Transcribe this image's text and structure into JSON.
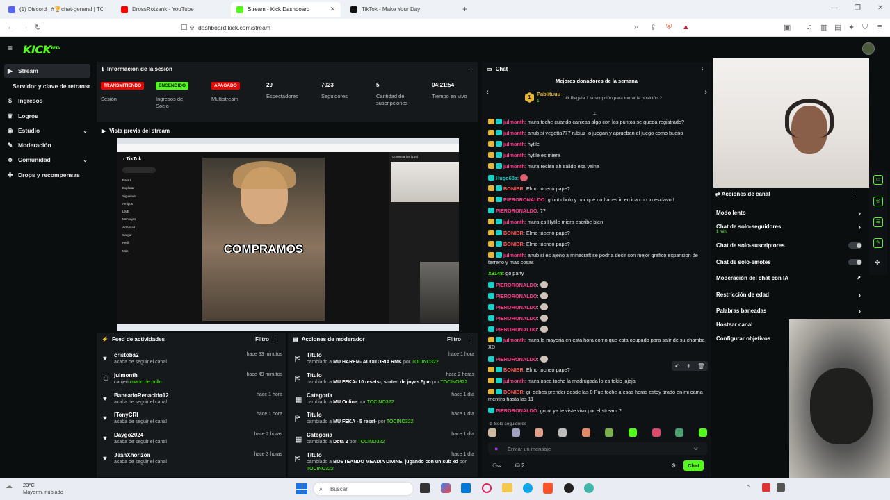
{
  "browser": {
    "tabs": [
      {
        "label": "(1) Discord | #🏆chat-general | TO",
        "color": "#5865f2"
      },
      {
        "label": "DrossRotzank - YouTube",
        "color": "#ff0000"
      },
      {
        "label": "Stream - Kick Dashboard",
        "color": "#53fc18"
      },
      {
        "label": "TikTok - Make Your Day",
        "color": "#111111"
      }
    ],
    "url": "dashboard.kick.com/stream"
  },
  "app": {
    "logo": "KICK",
    "logo_tag": "BETA"
  },
  "sidebar": {
    "items": [
      {
        "label": "Stream",
        "icon": "play-icon"
      },
      {
        "label": "Servidor y clave de retransmisión"
      },
      {
        "label": "Ingresos",
        "icon": "money-icon"
      },
      {
        "label": "Logros",
        "icon": "trophy-icon"
      },
      {
        "label": "Estudio",
        "icon": "studio-icon"
      },
      {
        "label": "Moderación",
        "icon": "wrench-icon"
      },
      {
        "label": "Comunidad",
        "icon": "people-icon"
      },
      {
        "label": "Drops y recompensas",
        "icon": "gift-icon"
      }
    ]
  },
  "session": {
    "title": "Información de la sesión",
    "stats": [
      {
        "badge": "TRANSMITIENDO",
        "label": "Sesión",
        "color": "#eb0400"
      },
      {
        "badge": "ENCENDIDO",
        "label": "Ingresos de Socio",
        "color": "#53fc18"
      },
      {
        "badge": "APAGADO",
        "label": "Multistream",
        "color": "#eb0400"
      },
      {
        "value": "29",
        "label": "Espectadores"
      },
      {
        "value": "7023",
        "label": "Seguidores"
      },
      {
        "value": "5",
        "label": "Cantidad de suscripciones"
      },
      {
        "value": "04:21:54",
        "label": "Tiempo en vivo"
      }
    ]
  },
  "preview": {
    "title": "Vista previa del stream",
    "overlay_text": "COMPRAMOS",
    "tiktok_label": "TikTok",
    "comments_label": "Comentarios (159)",
    "tiktok_menu": [
      "Para ti",
      "Explorar",
      "Siguiendo",
      "Amigos",
      "LIVE",
      "Mensajes",
      "Actividad",
      "Cargar",
      "Perfil",
      "Más"
    ]
  },
  "feed": {
    "title": "Feed de actividades",
    "filter": "Filtro",
    "items": [
      {
        "name": "cristoba2",
        "desc": "acaba de seguir el canal",
        "time": "hace 33 minutos",
        "icon": "heart-icon"
      },
      {
        "name": "julmonth",
        "desc": "canjeó",
        "highlight": "cuarto de pollo",
        "time": "hace 49 minutos",
        "icon": "reward-icon"
      },
      {
        "name": "BaneadoRenacido12",
        "desc": "acaba de seguir el canal",
        "time": "hace 1 hora",
        "icon": "heart-icon"
      },
      {
        "name": "ITonyCRI",
        "desc": "acaba de seguir el canal",
        "time": "hace 1 hora",
        "icon": "heart-icon"
      },
      {
        "name": "Daygo2024",
        "desc": "acaba de seguir el canal",
        "time": "hace 2 horas",
        "icon": "heart-icon"
      },
      {
        "name": "JeanXhorizon",
        "desc": "acaba de seguir el canal",
        "time": "hace 3 horas",
        "icon": "heart-icon"
      }
    ]
  },
  "mod": {
    "title": "Acciones de moderador",
    "filter": "Filtro",
    "items": [
      {
        "name": "Título",
        "pre": "cambiado a",
        "value": "MU HAREM- AUDITORIA RMK",
        "by": "por",
        "user": "TOCINO322",
        "time": "hace 1 hora"
      },
      {
        "name": "Título",
        "pre": "cambiado a",
        "value": "MU FEKA- 10 resets-, sorteo de joyas 5pm",
        "by": "por",
        "user": "TOCINO322",
        "time": "hace 2 horas"
      },
      {
        "name": "Categoría",
        "pre": "cambiado a",
        "value": "MU Online",
        "by": "por",
        "user": "TOCINO322",
        "time": "hace 1 día"
      },
      {
        "name": "Título",
        "pre": "cambiado a",
        "value": "MU FEKA - 5 reset-",
        "by": "por",
        "user": "TOCINO322",
        "time": "hace 1 día"
      },
      {
        "name": "Categoría",
        "pre": "cambiado a",
        "value": "Dota 2",
        "by": "por",
        "user": "TOCINO322",
        "time": "hace 1 día"
      },
      {
        "name": "Título",
        "pre": "cambiado a",
        "value": "BOSTEANDO MEADIA DIVINE, jugando con un sub xd",
        "by": "por",
        "user": "TOCINO322",
        "time": "hace 1 día"
      }
    ]
  },
  "chat": {
    "title": "Chat",
    "donors_title": "Mejores donadores de la semana",
    "top_donor": "Pablituuu",
    "top_donor_count": "1",
    "rank": "1",
    "gift_hint": "Regala 1 suscripción para tomar la posición 2",
    "messages": [
      {
        "user": "julmonth",
        "color": "#ff3b8b",
        "badges": [
          "b1",
          "b2"
        ],
        "text": ": mura toche cuando canjeas algo con los puntos se queda registrado?"
      },
      {
        "user": "julmonth",
        "color": "#ff3b8b",
        "badges": [
          "b1",
          "b2"
        ],
        "text": ": anub si vegetta777 rubiuz lo juegan y aprueban el juego como bueno"
      },
      {
        "user": "julmonth",
        "color": "#ff3b8b",
        "badges": [
          "b1",
          "b2"
        ],
        "text": ": hytile"
      },
      {
        "user": "julmonth",
        "color": "#ff3b8b",
        "badges": [
          "b1",
          "b2"
        ],
        "text": ": hytile es miera"
      },
      {
        "user": "julmonth",
        "color": "#ff3b8b",
        "badges": [
          "b1",
          "b2"
        ],
        "text": ": mura recien ah salido esa vaina"
      },
      {
        "user": "Hugo68s",
        "color": "#1ad0c9",
        "badges": [
          "b2"
        ],
        "text": ": "
      },
      {
        "user": "BONIBR",
        "color": "#ff5555",
        "badges": [
          "b1",
          "b2"
        ],
        "text": ": Elmo toceno pape?"
      },
      {
        "user": "PIERORONALDO",
        "color": "#ff3b8b",
        "badges": [
          "b1",
          "b2"
        ],
        "text": ": grunt cholo y por qué no haces iri en ica con tu esclavo !"
      },
      {
        "user": "PIERORONALDO",
        "color": "#ff3b8b",
        "badges": [
          "b2"
        ],
        "text": ": ??"
      },
      {
        "user": "julmonth",
        "color": "#ff3b8b",
        "badges": [
          "b1",
          "b2"
        ],
        "text": ": mura es Hytile miera escribe bien"
      },
      {
        "user": "BONIBR",
        "color": "#ff5555",
        "badges": [
          "b1",
          "b2"
        ],
        "text": ": Elmo toceno pape?"
      },
      {
        "user": "BONIBR",
        "color": "#ff5555",
        "badges": [
          "b1",
          "b2"
        ],
        "text": ": Elmo tocneo pape?"
      },
      {
        "user": "julmonth",
        "color": "#ff3b8b",
        "badges": [
          "b1",
          "b2"
        ],
        "text": ": anub si es ajeno a minecraft se podría decir con mejor grafico expansion de terreno y mas cosas"
      },
      {
        "user": "X3148",
        "color": "#53fc18",
        "badges": [],
        "text": ": go party"
      },
      {
        "user": "PIERORONALDO",
        "color": "#ff3b8b",
        "badges": [
          "b2"
        ],
        "text": ": "
      },
      {
        "user": "PIERORONALDO",
        "color": "#ff3b8b",
        "badges": [
          "b2"
        ],
        "text": ": "
      },
      {
        "user": "PIERORONALDO",
        "color": "#ff3b8b",
        "badges": [
          "b2"
        ],
        "text": ": "
      },
      {
        "user": "PIERORONALDO",
        "color": "#ff3b8b",
        "badges": [
          "b2"
        ],
        "text": ": "
      },
      {
        "user": "PIERORONALDO",
        "color": "#ff3b8b",
        "badges": [
          "b2"
        ],
        "text": ": "
      },
      {
        "user": "julmonth",
        "color": "#ff3b8b",
        "badges": [
          "b1",
          "b2"
        ],
        "text": ": mura la mayoria en esta hora como que esta ocupado para salir de su chamba XD"
      },
      {
        "user": "PIERORONALDO",
        "color": "#ff3b8b",
        "badges": [
          "b2"
        ],
        "text": ": "
      },
      {
        "user": "BONIBR",
        "color": "#ff5555",
        "badges": [
          "b1",
          "b2"
        ],
        "text": ": Elmo tocneo pape?"
      },
      {
        "user": "julmonth",
        "color": "#ff3b8b",
        "badges": [
          "b1",
          "b2"
        ],
        "text": ": mura osea toche la madrugada lo es tokio jajaja"
      },
      {
        "user": "BONIBR",
        "color": "#ff5555",
        "badges": [
          "b1",
          "b2"
        ],
        "text": ": gil debes prender desde las 8 Pue toche a esas horas estoy tirado en mi cama mentira hasta las 11"
      },
      {
        "user": "PIERORONALDO",
        "color": "#ff3b8b",
        "badges": [
          "b2"
        ],
        "text": ": grunt ya te viste vivo por el stream ?"
      }
    ],
    "mode": "Solo seguidores",
    "input_placeholder": "Enviar un mensaje",
    "viewer_count": "2",
    "send_label": "Chat"
  },
  "channel_actions": {
    "title": "Acciones de canal",
    "items": [
      {
        "label": "Modo lento",
        "type": "arrow"
      },
      {
        "label": "Chat de solo-seguidores",
        "sub": "1 min",
        "type": "arrow"
      },
      {
        "label": "Chat de solo-suscriptores",
        "type": "toggle"
      },
      {
        "label": "Chat de solo-emotes",
        "type": "toggle"
      },
      {
        "label": "Moderación del chat con IA",
        "type": "link"
      },
      {
        "label": "Restricción de edad",
        "type": "arrow"
      },
      {
        "label": "Palabras baneadas",
        "type": "arrow"
      },
      {
        "label": "Hostear canal",
        "type": "none"
      },
      {
        "label": "Configurar objetivos",
        "type": "none"
      }
    ]
  },
  "taskbar": {
    "weather_temp": "23°C",
    "weather_desc": "Mayorm. nublado",
    "search_placeholder": "Buscar"
  }
}
